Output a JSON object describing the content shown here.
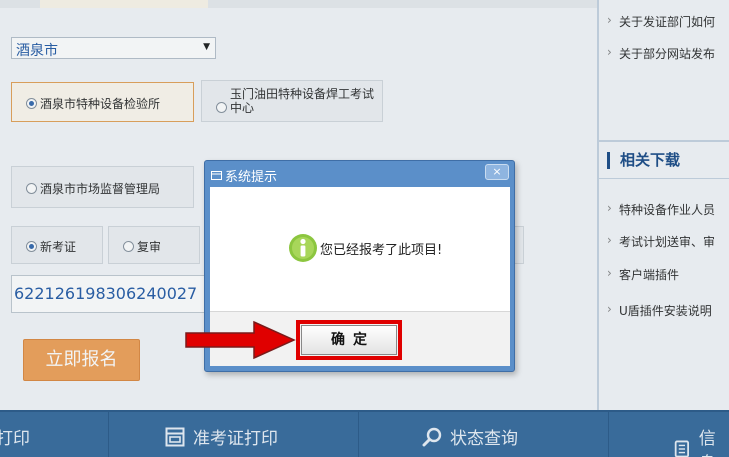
{
  "form": {
    "city_select": "酒泉市",
    "org_options": [
      {
        "label": "酒泉市特种设备检验所",
        "selected": true
      },
      {
        "label_line1": "玉门油田特种设备焊工考试",
        "label_line2": "中心",
        "selected": false
      },
      {
        "label": "酒泉市市场监督管理局",
        "selected": false
      }
    ],
    "exam_types": [
      {
        "label": "新考证",
        "selected": true
      },
      {
        "label": "复审",
        "selected": false
      }
    ],
    "id_number": "622126198306240027",
    "apply_button": "立即报名"
  },
  "right_panel": {
    "notice_links": [
      "关于发证部门如何",
      "关于部分网站发布"
    ],
    "downloads_title": "相关下载",
    "download_links": [
      "特种设备作业人员",
      "考试计划送审、审",
      "客户端插件",
      "U盾插件安装说明"
    ]
  },
  "footer": {
    "items": [
      "打印",
      "准考证打印",
      "状态查询",
      "信息"
    ]
  },
  "dialog": {
    "title": "系统提示",
    "close_label": "×",
    "message": "您已经报考了此项目!",
    "ok_label": "确定"
  },
  "colors": {
    "dialog_frame": "#5b8fc9",
    "footer_bg": "#3b6e9f",
    "highlight_red": "#e00000",
    "apply_orange": "#f0a35c",
    "info_icon_green": "#8cc63f"
  },
  "icons": {
    "dialog_title": "window-icon",
    "dialog_message": "info-icon",
    "footer_ticket": "ticket-print-icon",
    "footer_status": "magnifier-icon",
    "footer_info": "document-icon",
    "annotation": "red-arrow"
  }
}
